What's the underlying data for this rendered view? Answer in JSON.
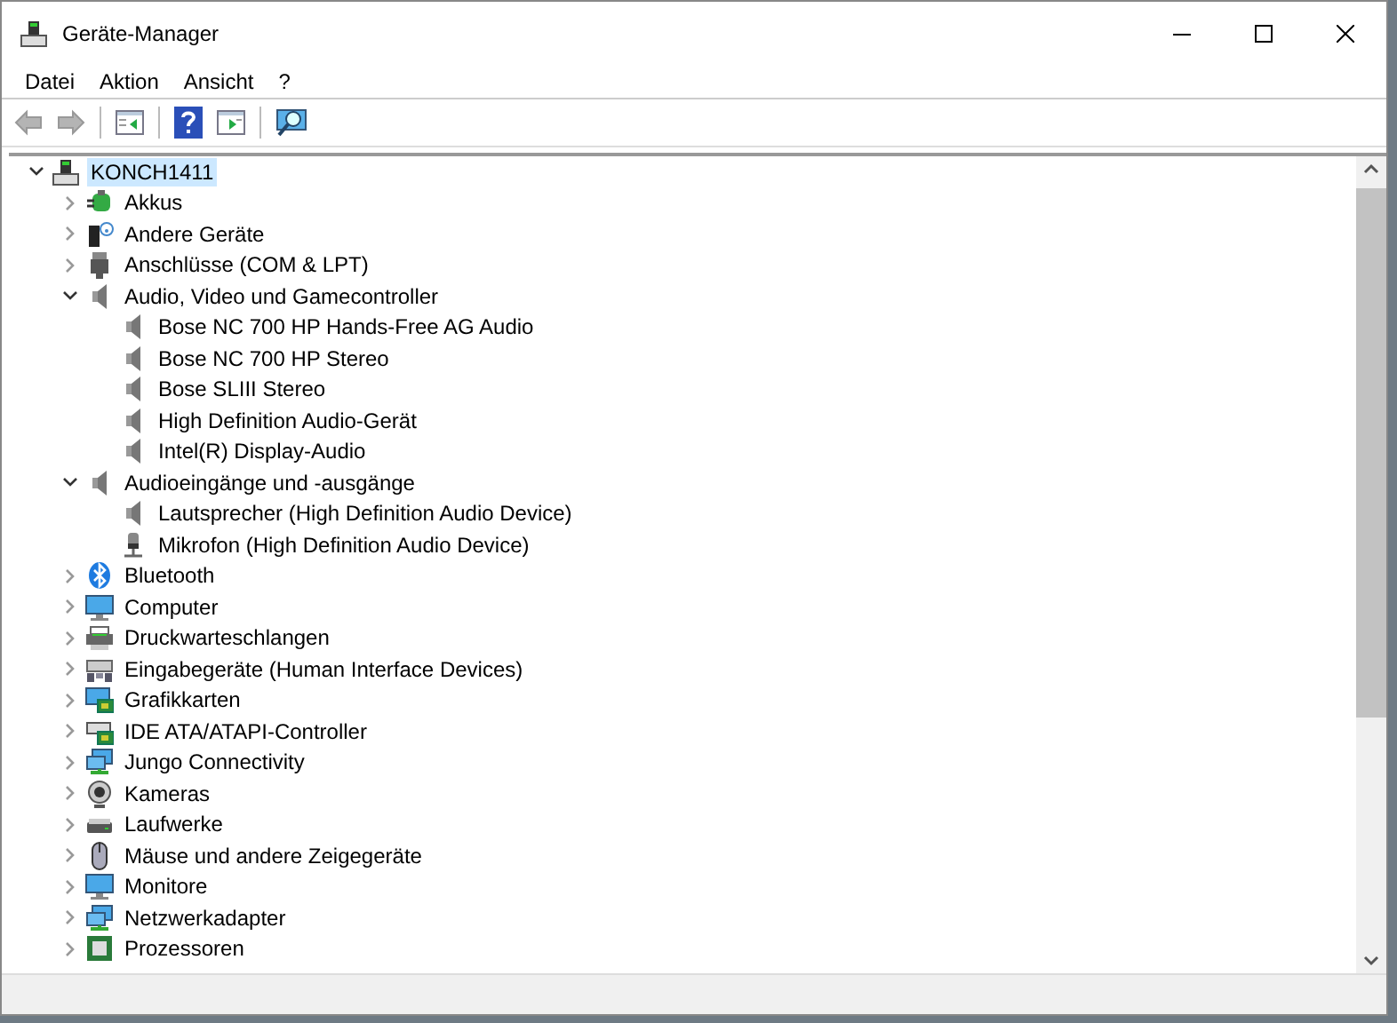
{
  "window": {
    "title": "Geräte-Manager"
  },
  "menu": [
    "Datei",
    "Aktion",
    "Ansicht",
    "?"
  ],
  "toolbar": [
    {
      "kind": "back",
      "disabled": true
    },
    {
      "kind": "forward",
      "disabled": true
    },
    {
      "kind": "separator"
    },
    {
      "kind": "console",
      "disabled": false
    },
    {
      "kind": "separator"
    },
    {
      "kind": "help",
      "disabled": false
    },
    {
      "kind": "pane",
      "disabled": false
    },
    {
      "kind": "separator"
    },
    {
      "kind": "scan",
      "disabled": false
    }
  ],
  "tree": [
    {
      "label": "KONCH1411",
      "kind": "computer",
      "expanded": true,
      "selected": true,
      "children": [
        {
          "label": "Akkus",
          "kind": "battery",
          "expanded": false,
          "selected": false
        },
        {
          "label": "Andere Geräte",
          "kind": "unknown",
          "expanded": false,
          "selected": false
        },
        {
          "label": "Anschlüsse (COM & LPT)",
          "kind": "port",
          "expanded": false,
          "selected": false
        },
        {
          "label": "Audio, Video und Gamecontroller",
          "kind": "speaker",
          "expanded": true,
          "selected": false,
          "children": [
            {
              "label": "Bose NC 700 HP Hands-Free AG Audio",
              "kind": "speaker",
              "selected": false
            },
            {
              "label": "Bose NC 700 HP Stereo",
              "kind": "speaker",
              "selected": false
            },
            {
              "label": "Bose SLIII Stereo",
              "kind": "speaker",
              "selected": false
            },
            {
              "label": "High Definition Audio-Gerät",
              "kind": "speaker",
              "selected": false
            },
            {
              "label": "Intel(R) Display-Audio",
              "kind": "speaker",
              "selected": false
            }
          ]
        },
        {
          "label": "Audioeingänge und -ausgänge",
          "kind": "speaker",
          "expanded": true,
          "selected": false,
          "children": [
            {
              "label": "Lautsprecher (High Definition Audio Device)",
              "kind": "speaker",
              "selected": false
            },
            {
              "label": "Mikrofon (High Definition Audio Device)",
              "kind": "microphone",
              "selected": false
            }
          ]
        },
        {
          "label": "Bluetooth",
          "kind": "bluetooth",
          "expanded": false,
          "selected": false
        },
        {
          "label": "Computer",
          "kind": "monitor",
          "expanded": false,
          "selected": false
        },
        {
          "label": "Druckwarteschlangen",
          "kind": "printer",
          "expanded": false,
          "selected": false
        },
        {
          "label": "Eingabegeräte (Human Interface Devices)",
          "kind": "keyboard",
          "expanded": false,
          "selected": false
        },
        {
          "label": "Grafikkarten",
          "kind": "display-card",
          "expanded": false,
          "selected": false
        },
        {
          "label": "IDE ATA/ATAPI-Controller",
          "kind": "controller",
          "expanded": false,
          "selected": false
        },
        {
          "label": "Jungo Connectivity",
          "kind": "network",
          "expanded": false,
          "selected": false
        },
        {
          "label": "Kameras",
          "kind": "camera",
          "expanded": false,
          "selected": false
        },
        {
          "label": "Laufwerke",
          "kind": "drive",
          "expanded": false,
          "selected": false
        },
        {
          "label": "Mäuse und andere Zeigegeräte",
          "kind": "mouse",
          "expanded": false,
          "selected": false
        },
        {
          "label": "Monitore",
          "kind": "monitor",
          "expanded": false,
          "selected": false
        },
        {
          "label": "Netzwerkadapter",
          "kind": "network",
          "expanded": false,
          "selected": false
        },
        {
          "label": "Prozessoren",
          "kind": "cpu",
          "expanded": false,
          "selected": false
        }
      ]
    }
  ]
}
